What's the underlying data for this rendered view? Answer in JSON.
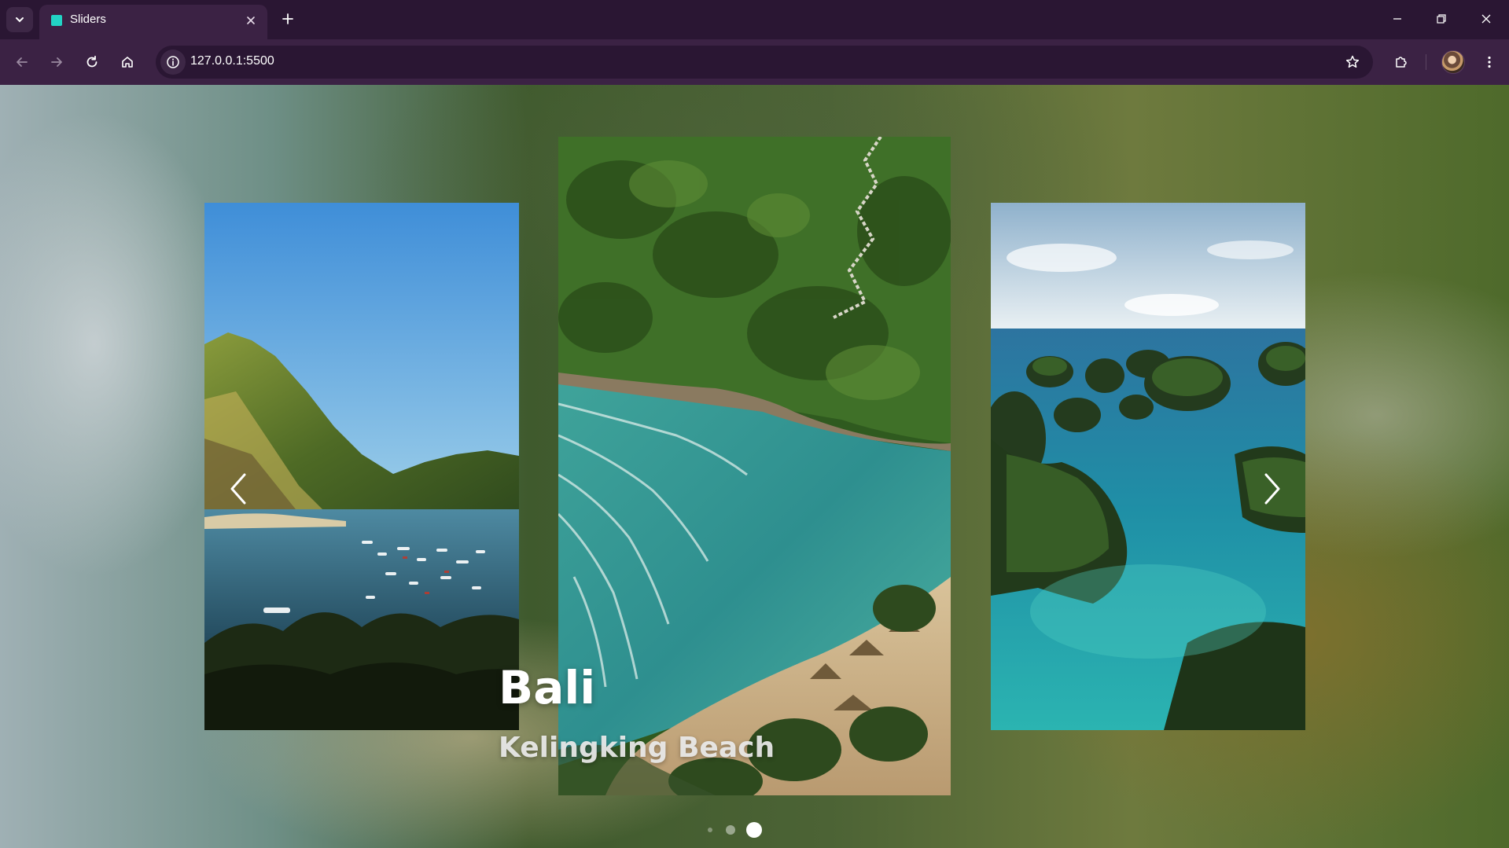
{
  "browser": {
    "tab_title": "Sliders",
    "url": "127.0.0.1:5500",
    "tab_menu_icon": "chevron-down-icon",
    "favicon_color": "#22d3c5",
    "icons": {
      "close_tab": "close-icon",
      "new_tab": "plus-icon",
      "back": "arrow-left-icon",
      "forward": "arrow-right-icon",
      "reload": "reload-icon",
      "home": "home-icon",
      "site_info": "info-icon",
      "bookmark": "star-icon",
      "extensions": "puzzle-icon",
      "menu": "kebab-menu-icon",
      "minimize": "minimize-icon",
      "restore": "restore-icon",
      "close_window": "close-icon"
    },
    "theme_colors": {
      "tabbar": "#2a1633",
      "toolbar": "#3b2244"
    }
  },
  "slider": {
    "current": {
      "title": "Bali",
      "subtitle": "Kelingking Beach"
    },
    "slides": [
      {
        "position": "previous",
        "scene": "mountain bay with boats"
      },
      {
        "position": "current",
        "scene": "cliff beach with stairs"
      },
      {
        "position": "next",
        "scene": "tropical karst islands"
      }
    ],
    "pagination": {
      "count": 3,
      "active_index": 2
    },
    "controls": {
      "prev_icon": "chevron-left-icon",
      "next_icon": "chevron-right-icon"
    }
  }
}
